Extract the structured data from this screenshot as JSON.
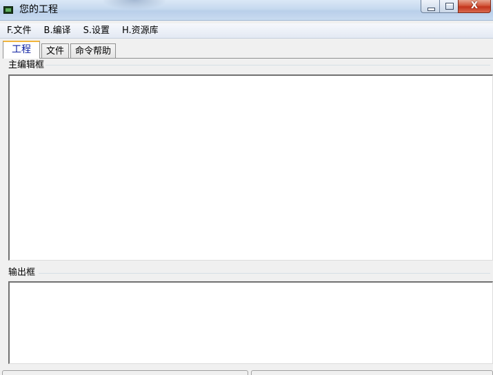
{
  "window": {
    "title": "您的工程",
    "close_glyph": "X"
  },
  "menu": {
    "items": [
      "F.文件",
      "B.编译",
      "S.设置",
      "H.资源库"
    ]
  },
  "tabs": [
    {
      "label": "工程",
      "active": true
    },
    {
      "label": "文件",
      "active": false
    },
    {
      "label": "命令帮助",
      "active": false
    }
  ],
  "main_editor": {
    "label": "主编辑框",
    "value": ""
  },
  "output": {
    "label": "输出框",
    "value": ""
  },
  "colors": {
    "active_tab_text": "#0b1fa0",
    "active_tab_accent": "#f2b53a",
    "close_button": "#c3341c"
  }
}
